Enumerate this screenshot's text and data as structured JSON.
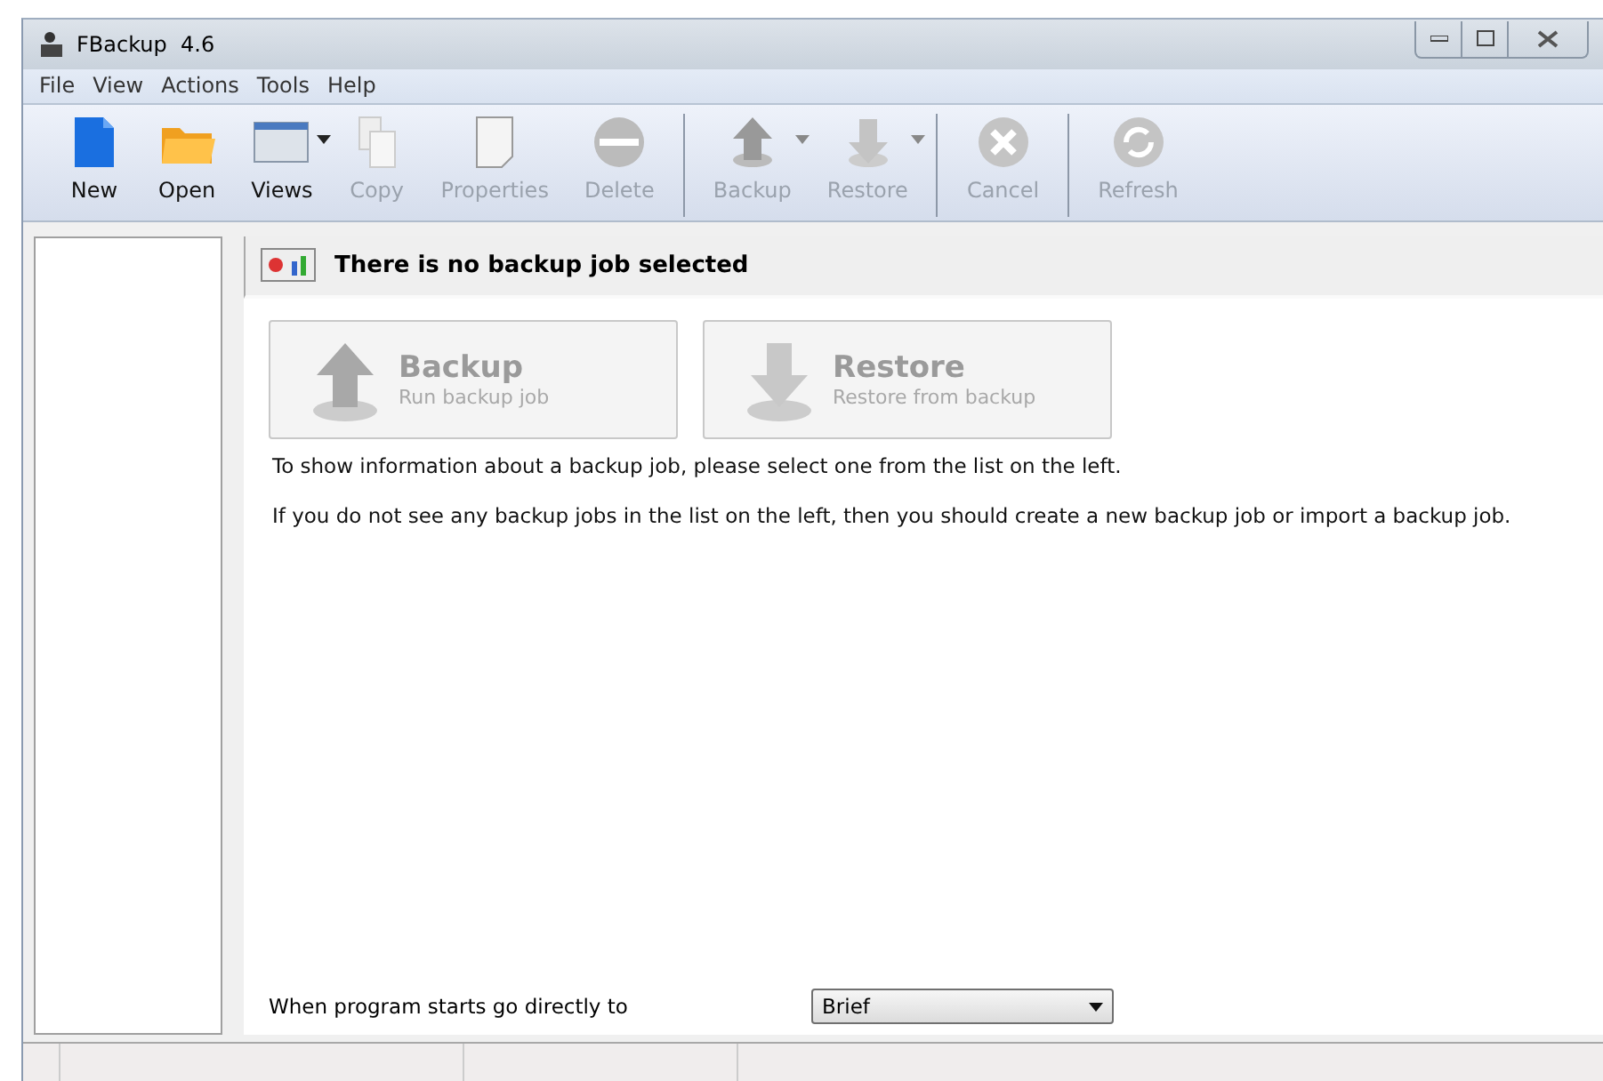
{
  "window": {
    "title": "FBackup  4.6"
  },
  "menu": [
    "File",
    "View",
    "Actions",
    "Tools",
    "Help"
  ],
  "toolbar": [
    [
      {
        "kind": "new",
        "label": "New",
        "disabled": false,
        "dropdown": false
      },
      {
        "kind": "open",
        "label": "Open",
        "disabled": false,
        "dropdown": false
      },
      {
        "kind": "views",
        "label": "Views",
        "disabled": false,
        "dropdown": true
      },
      {
        "kind": "copy",
        "label": "Copy",
        "disabled": true,
        "dropdown": false
      },
      {
        "kind": "properties",
        "label": "Properties",
        "disabled": true,
        "dropdown": false
      },
      {
        "kind": "delete",
        "label": "Delete",
        "disabled": true,
        "dropdown": false
      }
    ],
    [
      {
        "kind": "backup",
        "label": "Backup",
        "disabled": true,
        "dropdown": true
      },
      {
        "kind": "restore",
        "label": "Restore",
        "disabled": true,
        "dropdown": true
      }
    ],
    [
      {
        "kind": "cancel",
        "label": "Cancel",
        "disabled": true,
        "dropdown": false
      }
    ],
    [
      {
        "kind": "refresh",
        "label": "Refresh",
        "disabled": true,
        "dropdown": false
      }
    ]
  ],
  "header": "There is no backup job selected",
  "actions": [
    {
      "kind": "backup",
      "title": "Backup",
      "subtitle": "Run backup job"
    },
    {
      "kind": "restore",
      "title": "Restore",
      "subtitle": "Restore from backup"
    }
  ],
  "messages": [
    "To show information about a backup job, please select one from the list on the left.",
    "If you do not see any backup jobs in the list on the left, then you should create a new backup job or import a backup job."
  ],
  "startup": {
    "label": "When program starts go directly to",
    "value": "Brief"
  }
}
